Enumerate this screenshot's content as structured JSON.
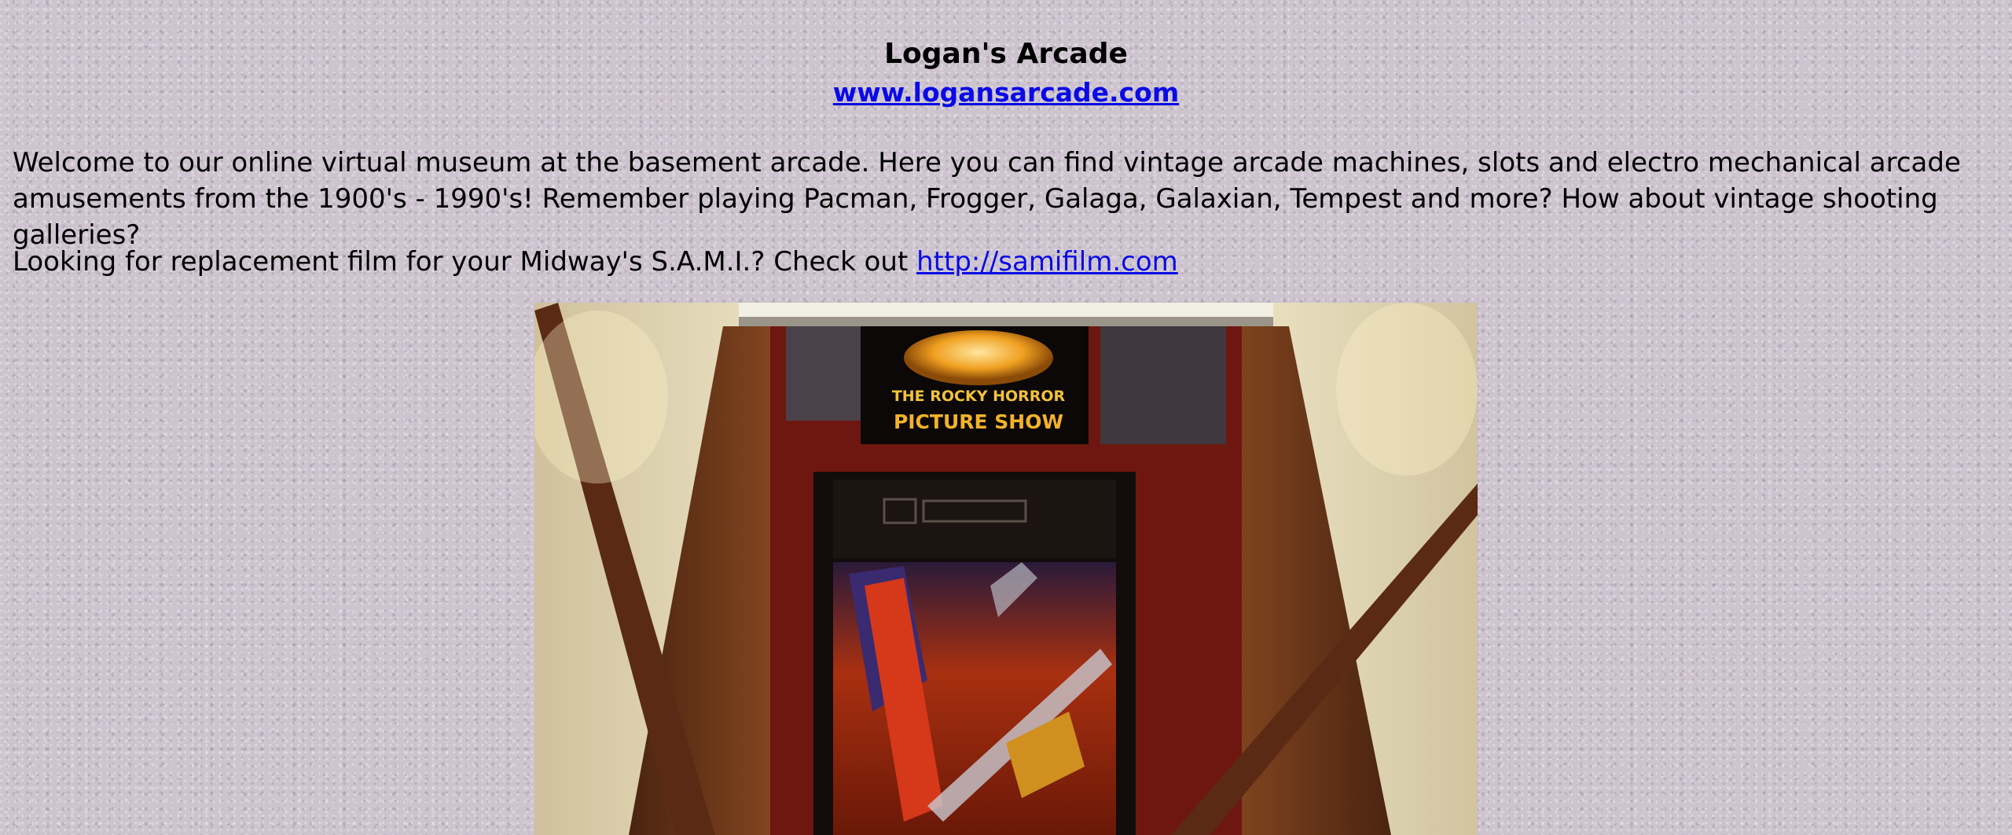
{
  "header": {
    "title": "Logan's Arcade",
    "site_link": "www.logansarcade.com"
  },
  "intro": {
    "text": "Welcome to our online virtual museum at the basement arcade.  Here you can find vintage arcade machines, slots and electro mechanical arcade amusements from the 1900's - 1990's!  Remember playing Pacman, Frogger, Galaga, Galaxian, Tempest and more?  How about vintage shooting galleries?"
  },
  "film": {
    "text": "Looking for replacement film for your Midway's S.A.M.I.?  Check out ",
    "link": "http://samifilm.com"
  },
  "photo": {
    "marquee_line1": "THE ROCKY HORROR",
    "marquee_line2": "PICTURE SHOW",
    "colors": {
      "wall": "#d8ccaa",
      "wood": "#6e3a1c",
      "red_wall": "#7a1a10"
    }
  }
}
